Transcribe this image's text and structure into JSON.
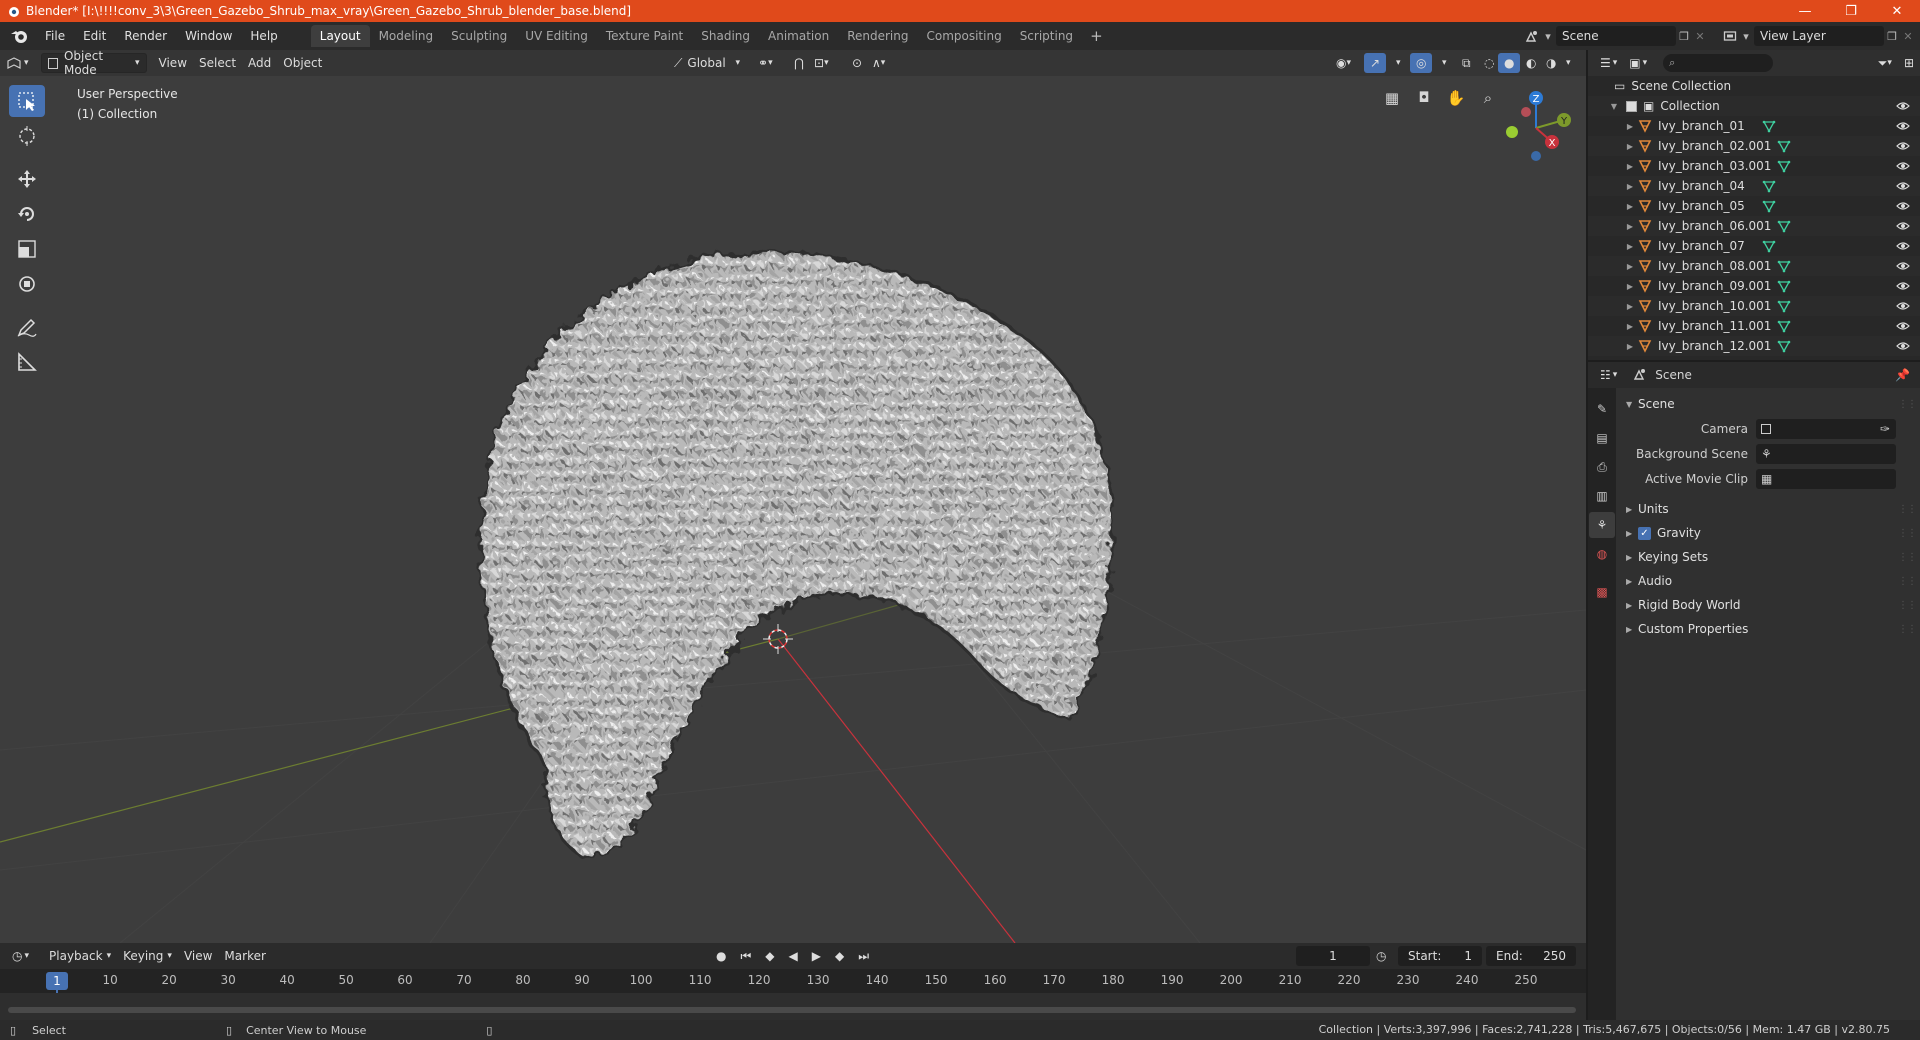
{
  "window": {
    "title": "Blender* [I:\\!!!!conv_3\\3\\Green_Gazebo_Shrub_max_vray\\Green_Gazebo_Shrub_blender_base.blend]",
    "minimize": "—",
    "maximize": "❐",
    "close": "✕"
  },
  "menu": [
    "File",
    "Edit",
    "Render",
    "Window",
    "Help"
  ],
  "workspaces": [
    "Layout",
    "Modeling",
    "Sculpting",
    "UV Editing",
    "Texture Paint",
    "Shading",
    "Animation",
    "Rendering",
    "Compositing",
    "Scripting"
  ],
  "active_workspace": "Layout",
  "workspace_add": "+",
  "scene_name": "Scene",
  "view_layer_name": "View Layer",
  "viewport": {
    "mode": "Object Mode",
    "menus": [
      "View",
      "Select",
      "Add",
      "Object"
    ],
    "orientation": "Global",
    "overlay_line1": "User Perspective",
    "overlay_line2": "(1) Collection",
    "gizmo_axes": {
      "z": "Z",
      "y": "Y",
      "x": "X"
    }
  },
  "timeline": {
    "menus": [
      "Playback",
      "Keying",
      "View",
      "Marker"
    ],
    "current_frame": "1",
    "start_label": "Start:",
    "start": "1",
    "end_label": "End:",
    "end": "250",
    "ticks": [
      10,
      20,
      30,
      40,
      50,
      60,
      70,
      80,
      90,
      100,
      110,
      120,
      130,
      140,
      150,
      160,
      170,
      180,
      190,
      200,
      210,
      220,
      230,
      240,
      250
    ],
    "cursor_label": "1"
  },
  "statusbar": {
    "select": "Select",
    "center_view": "Center View to Mouse",
    "stats": "Collection | Verts:3,397,996 | Faces:2,741,228 | Tris:5,467,675 | Objects:0/56 | Mem: 1.47 GB | v2.80.75"
  },
  "outliner": {
    "root": "Scene Collection",
    "collection": "Collection",
    "items": [
      "Ivy_branch_01",
      "Ivy_branch_02.001",
      "Ivy_branch_03.001",
      "Ivy_branch_04",
      "Ivy_branch_05",
      "Ivy_branch_06.001",
      "Ivy_branch_07",
      "Ivy_branch_08.001",
      "Ivy_branch_09.001",
      "Ivy_branch_10.001",
      "Ivy_branch_11.001",
      "Ivy_branch_12.001"
    ]
  },
  "properties": {
    "context": "Scene",
    "panel_title": "Scene",
    "fields": [
      {
        "label": "Camera"
      },
      {
        "label": "Background Scene"
      },
      {
        "label": "Active Movie Clip"
      }
    ],
    "subpanels": [
      "Units",
      "Gravity",
      "Keying Sets",
      "Audio",
      "Rigid Body World",
      "Custom Properties"
    ],
    "gravity_checked": true
  },
  "colors": {
    "titlebar": "#e04a1b",
    "accent": "#4772b3",
    "viewport_bg": "#3d3d3d",
    "axis_x": "#c8323c",
    "axis_y": "#7d9a2b",
    "axis_z": "#2d7bd6",
    "mesh_icon": "#3fd0a0",
    "object_icon": "#e0883a"
  }
}
